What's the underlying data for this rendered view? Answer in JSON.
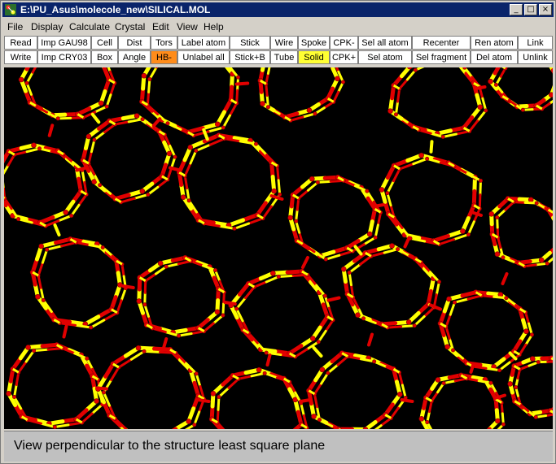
{
  "window": {
    "title": "E:\\PU_Asus\\molecole_new\\SILICAL.MOL",
    "minimize_glyph": "_",
    "maximize_glyph": "□",
    "close_glyph": "×"
  },
  "menu": {
    "items": [
      "File",
      "Display",
      "Calculate",
      "Crystal",
      "Edit",
      "View",
      "Help"
    ]
  },
  "toolbar": {
    "row1": [
      "Read",
      "Imp GAU98",
      "Cell",
      "Dist",
      "Tors",
      "Label atom",
      "Stick",
      "Wire",
      "Spoke",
      "CPK-",
      "Sel all atom",
      "Recenter",
      "Ren atom",
      "Link"
    ],
    "row2": [
      "Write",
      "Imp CRY03",
      "Box",
      "Angle",
      "HB-",
      "Unlabel all",
      "Stick+B",
      "Tube",
      "Solid",
      "CPK+",
      "Sel atom",
      "Sel fragment",
      "Del atom",
      "Unlink"
    ],
    "active_orange": "HB-",
    "active_yellow": "Solid"
  },
  "status": {
    "message": "View perpendicular to the structure least square plane"
  },
  "colors": {
    "title_bar": "#0a246a",
    "viewport_bg": "#000000",
    "bond_red": "#e10000",
    "bond_yellow": "#ffff00",
    "button_orange": "#ff8c1a",
    "button_yellow": "#ffff33"
  },
  "icons": {
    "app": "molecule-app-icon"
  }
}
